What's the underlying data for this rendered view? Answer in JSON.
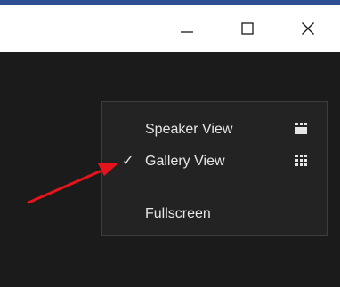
{
  "window_controls": {
    "minimize_icon": "minimize-icon",
    "maximize_icon": "maximize-icon",
    "close_icon": "close-icon"
  },
  "view_menu": {
    "items": [
      {
        "label": "Speaker View",
        "checked": false,
        "icon": "speaker-view-icon"
      },
      {
        "label": "Gallery View",
        "checked": true,
        "check_glyph": "✓",
        "icon": "gallery-view-icon"
      },
      {
        "label": "Fullscreen",
        "checked": false
      }
    ]
  },
  "colors": {
    "meeting_background": "#1b1b1b",
    "menu_background": "#232323",
    "menu_text": "#e6e6e6",
    "annotation_arrow": "#e5141b",
    "title_strip": "#2d4f93"
  }
}
